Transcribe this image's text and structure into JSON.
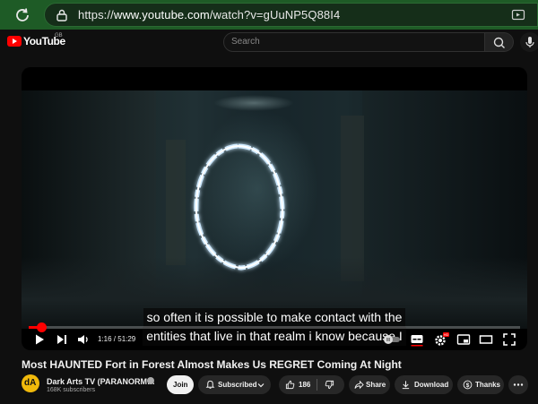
{
  "browser": {
    "url_prefix": "https://",
    "url_host": "www.youtube.com",
    "url_path": "/watch?v=gUuNP5Q88I4"
  },
  "masthead": {
    "logo_text": "YouTube",
    "country_code": "GB",
    "search_placeholder": "Search"
  },
  "player": {
    "subtitle_lines": [
      "so often it is possible to make contact with the",
      "entities that live in that realm i know because I"
    ],
    "time_display": "1:16 / 51:29",
    "progress": 0.025,
    "settings_badge": "HD"
  },
  "video": {
    "title": "Most HAUNTED Fort in Forest Almost Makes Us REGRET Coming At Night",
    "channel_name": "Dark Arts TV (PARANORM…",
    "subscribers": "168K subscribers",
    "avatar_text": "dA",
    "buttons": {
      "join": "Join",
      "subscribed": "Subscribed",
      "likes": "186",
      "share": "Share",
      "download": "Download",
      "thanks": "Thanks"
    }
  }
}
